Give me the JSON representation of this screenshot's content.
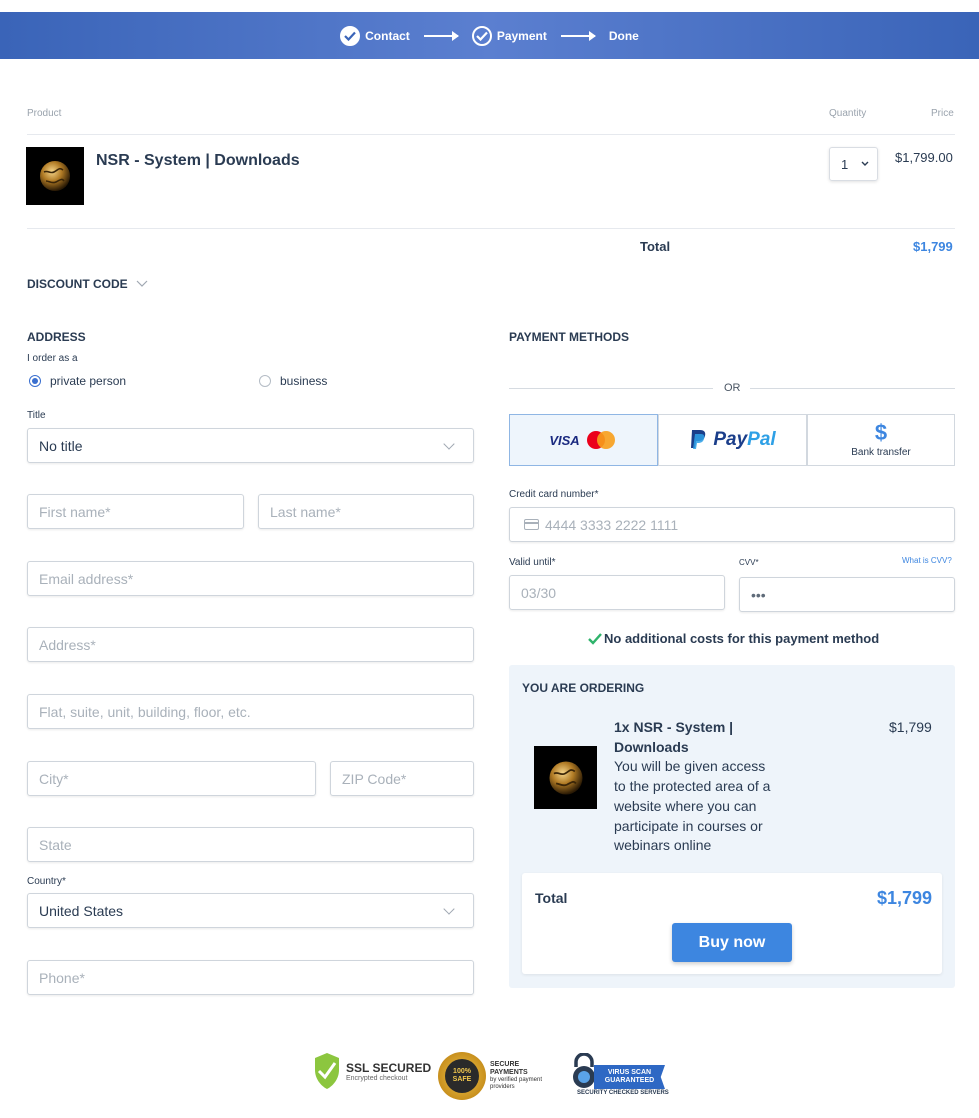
{
  "steps": {
    "contact": "Contact",
    "payment": "Payment",
    "done": "Done"
  },
  "table": {
    "product": "Product",
    "quantity": "Quantity",
    "price": "Price"
  },
  "product": {
    "name": "NSR - System | Downloads",
    "quantity": "1",
    "price": "$1,799.00",
    "image_icon": "globe-icon"
  },
  "totals": {
    "label": "Total",
    "value": "$1,799"
  },
  "discount": {
    "label": "DISCOUNT CODE"
  },
  "address": {
    "heading": "ADDRESS",
    "order_as": "I order as a",
    "option_private": "private person",
    "option_business": "business",
    "title_label": "Title",
    "title_value": "No title",
    "first_name": "First name*",
    "last_name": "Last name*",
    "email": "Email address*",
    "address": "Address*",
    "flat": "Flat, suite, unit, building, floor, etc.",
    "city": "City*",
    "zip": "ZIP Code*",
    "state": "State",
    "country_label": "Country*",
    "country_value": "United States",
    "phone": "Phone*"
  },
  "payment": {
    "heading": "PAYMENT METHODS",
    "or": "OR",
    "visa": "VISA",
    "paypal_pay": "Pay",
    "paypal_pal": "Pal",
    "bank_symbol": "$",
    "bank": "Bank transfer",
    "cc_label": "Credit card number*",
    "cc_placeholder": "4444 3333 2222 1111",
    "valid_label": "Valid until*",
    "valid_placeholder": "03/30",
    "cvv_label": "CVV*",
    "cvv_help": "What is CVV?",
    "cvv_placeholder": "•••",
    "no_costs": "No additional costs for this payment method",
    "accent": "#3d86e0"
  },
  "summary": {
    "heading": "YOU ARE ORDERING",
    "item_title": "1x NSR - System | Downloads",
    "item_desc": "You will be given access to the protected area of a website where you can participate in courses or webinars online",
    "item_price": "$1,799",
    "total_label": "Total",
    "total_value": "$1,799",
    "buy": "Buy now"
  },
  "badges": {
    "ssl_title": "SSL SECURED",
    "ssl_sub": "Encrypted checkout",
    "seal_text": "100% SAFE",
    "secure_title": "SECURE PAYMENTS",
    "secure_sub": "by verified payment providers",
    "virus_title": "VIRUS SCAN GUARANTEED",
    "virus_sub": "SECURITY CHECKED SERVERS"
  }
}
